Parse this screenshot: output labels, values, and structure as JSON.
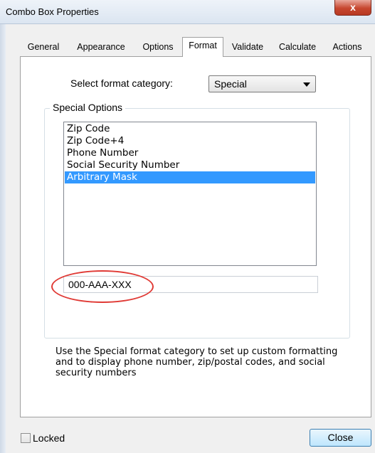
{
  "window": {
    "title": "Combo Box Properties",
    "close_glyph": "x"
  },
  "tabs": [
    {
      "label": "General",
      "active": false
    },
    {
      "label": "Appearance",
      "active": false
    },
    {
      "label": "Options",
      "active": false
    },
    {
      "label": "Format",
      "active": true
    },
    {
      "label": "Validate",
      "active": false
    },
    {
      "label": "Calculate",
      "active": false
    },
    {
      "label": "Actions",
      "active": false
    }
  ],
  "format": {
    "category_label": "Select format category:",
    "category_value": "Special",
    "special_options_label": "Special Options",
    "options": [
      {
        "label": "Zip Code",
        "selected": false
      },
      {
        "label": "Zip Code+4",
        "selected": false
      },
      {
        "label": "Phone Number",
        "selected": false
      },
      {
        "label": "Social Security Number",
        "selected": false
      },
      {
        "label": "Arbitrary Mask",
        "selected": true
      }
    ],
    "mask_value": "000-AAA-XXX",
    "description_lines": [
      "Use the Special format category to set up custom formatting",
      "and to display phone number, zip/postal codes, and social",
      "security numbers"
    ]
  },
  "footer": {
    "locked_label": "Locked",
    "locked_checked": false,
    "close_label": "Close"
  },
  "colors": {
    "selection": "#3399ff",
    "highlight_circle": "#e03a35",
    "close_caption": "#c7472f"
  },
  "icons": {
    "window_close": "close-icon",
    "dropdown": "chevron-down-icon"
  }
}
